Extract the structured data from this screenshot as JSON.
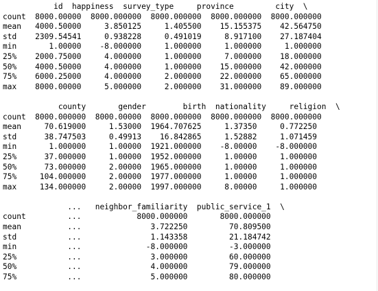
{
  "output": {
    "lines": [
      "           id  happiness  survey_type     province         city  \\",
      "count  8000.00000  8000.000000  8000.000000  8000.000000  8000.000000",
      "mean   4000.50000     3.850125     1.405500    15.155375    42.564750",
      "std    2309.54541     0.938228     0.491019     8.917100    27.187404",
      "min       1.00000    -8.000000     1.000000     1.000000     1.000000",
      "25%    2000.75000     4.000000     1.000000     7.000000    18.000000",
      "50%    4000.50000     4.000000     1.000000    15.000000    42.000000",
      "75%    6000.25000     4.000000     2.000000    22.000000    65.000000",
      "max    8000.00000     5.000000     2.000000    31.000000    89.000000",
      "",
      "            county       gender        birth  nationality     religion  \\",
      "count  8000.000000  8000.00000  8000.000000  8000.000000  8000.000000",
      "mean     70.619000     1.53000  1964.707625     1.37350     0.772250",
      "std      38.747503     0.49913    16.842865     1.52882     1.071459",
      "min       1.000000     1.00000  1921.000000    -8.00000    -8.000000",
      "25%      37.000000     1.00000  1952.000000     1.00000     1.000000",
      "50%      73.000000     2.00000  1965.000000     1.00000     1.000000",
      "75%     104.000000     2.00000  1977.000000     1.00000     1.000000",
      "max     134.000000     2.00000  1997.000000     8.00000     1.000000",
      "",
      "              ...   neighbor_familiarity  public_service_1  \\",
      "count         ...            8000.000000       8000.000000",
      "mean          ...               3.722250         70.809500",
      "std           ...               1.143358         21.184742",
      "min           ...              -8.000000         -3.000000",
      "25%           ...               3.000000         60.000000",
      "50%           ...               4.000000         79.000000",
      "75%           ...               5.000000         80.000000"
    ]
  }
}
